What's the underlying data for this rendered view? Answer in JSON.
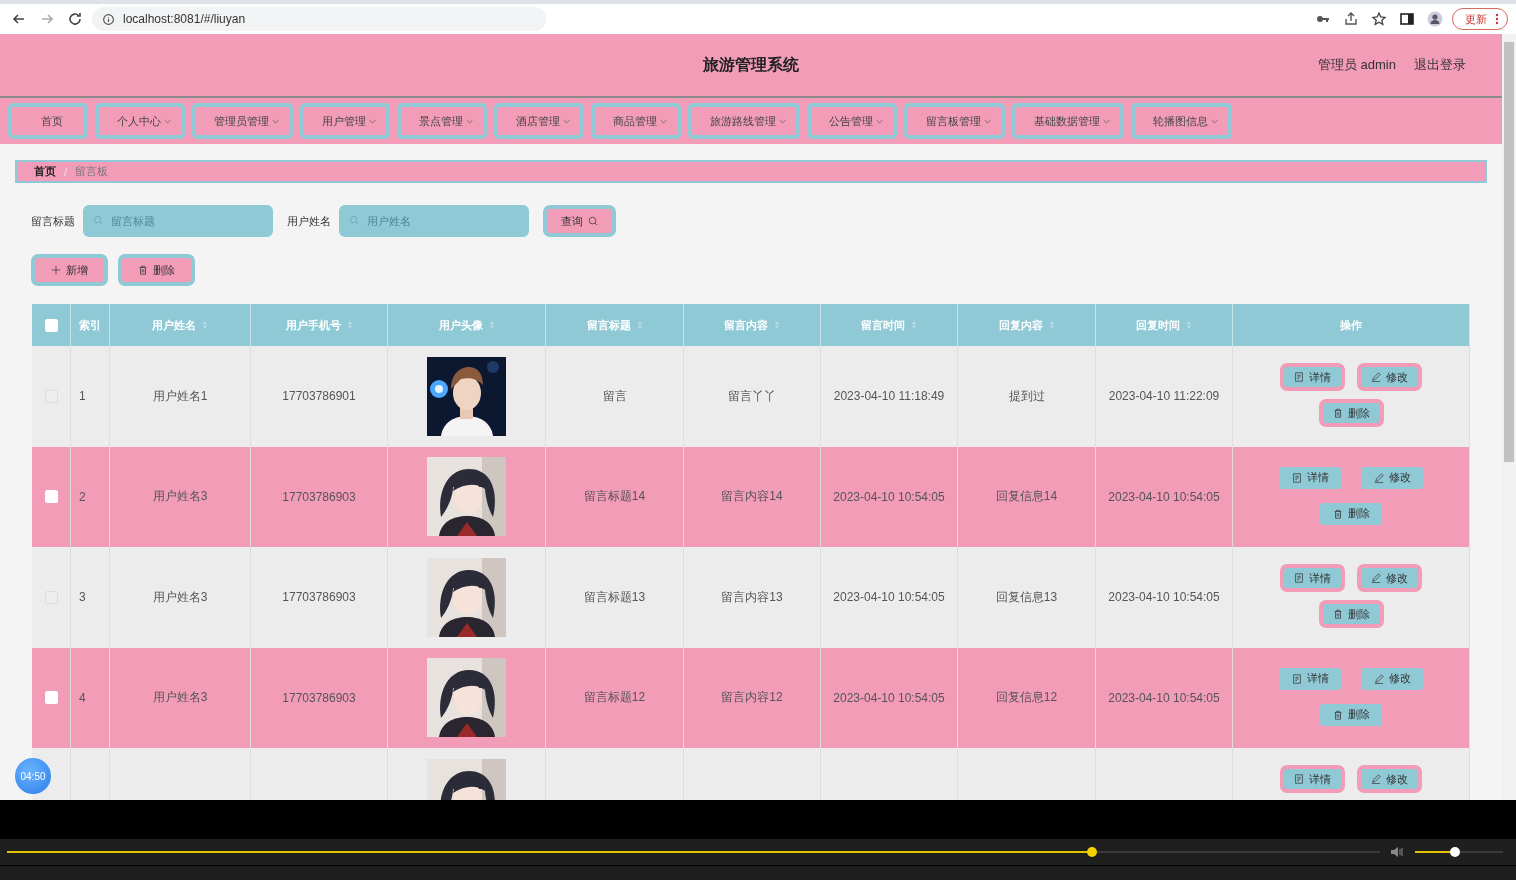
{
  "browser": {
    "url": "localhost:8081/#/liuyan",
    "update_label": "更新"
  },
  "header": {
    "title": "旅游管理系统",
    "user": "管理员 admin",
    "logout": "退出登录"
  },
  "nav": [
    {
      "label": "首页",
      "dropdown": false
    },
    {
      "label": "个人中心",
      "dropdown": true
    },
    {
      "label": "管理员管理",
      "dropdown": true
    },
    {
      "label": "用户管理",
      "dropdown": true
    },
    {
      "label": "景点管理",
      "dropdown": true
    },
    {
      "label": "酒店管理",
      "dropdown": true
    },
    {
      "label": "商品管理",
      "dropdown": true
    },
    {
      "label": "旅游路线管理",
      "dropdown": true
    },
    {
      "label": "公告管理",
      "dropdown": true
    },
    {
      "label": "留言板管理",
      "dropdown": true
    },
    {
      "label": "基础数据管理",
      "dropdown": true
    },
    {
      "label": "轮播图信息",
      "dropdown": true
    }
  ],
  "breadcrumb": {
    "separator": "/",
    "items": [
      {
        "label": "首页",
        "current": false
      },
      {
        "label": "留言板",
        "current": true
      }
    ]
  },
  "search": {
    "fields": [
      {
        "label": "留言标题",
        "placeholder": "留言标题"
      },
      {
        "label": "用户姓名",
        "placeholder": "用户姓名"
      }
    ],
    "button": "查询"
  },
  "actions": [
    {
      "label": "新增",
      "kind": "add"
    },
    {
      "label": "删除",
      "kind": "delete"
    }
  ],
  "table": {
    "all_checked": false,
    "columns": [
      {
        "label": "索引",
        "sortable": false
      },
      {
        "label": "用户姓名",
        "sortable": true
      },
      {
        "label": "用户手机号",
        "sortable": true
      },
      {
        "label": "用户头像",
        "sortable": true
      },
      {
        "label": "留言标题",
        "sortable": true
      },
      {
        "label": "留言内容",
        "sortable": true
      },
      {
        "label": "留言时间",
        "sortable": true
      },
      {
        "label": "回复内容",
        "sortable": true
      },
      {
        "label": "回复时间",
        "sortable": true
      },
      {
        "label": "操作",
        "sortable": false
      }
    ],
    "rows": [
      {
        "checked": false,
        "cells": [
          "1",
          "用户姓名1",
          "17703786901",
          null,
          "留言",
          "留言丫丫",
          "2023-04-10 11:18:49",
          "提到过",
          "2023-04-10 11:22:09"
        ],
        "actions": [
          {
            "label": "详情",
            "kind": "detail"
          },
          {
            "label": "修改",
            "kind": "edit"
          },
          {
            "label": "删除",
            "kind": "delete"
          }
        ]
      },
      {
        "checked": false,
        "cells": [
          "2",
          "用户姓名3",
          "17703786903",
          null,
          "留言标题14",
          "留言内容14",
          "2023-04-10 10:54:05",
          "回复信息14",
          "2023-04-10 10:54:05"
        ],
        "actions": [
          {
            "label": "详情",
            "kind": "detail"
          },
          {
            "label": "修改",
            "kind": "edit"
          },
          {
            "label": "删除",
            "kind": "delete"
          }
        ]
      },
      {
        "checked": false,
        "cells": [
          "3",
          "用户姓名3",
          "17703786903",
          null,
          "留言标题13",
          "留言内容13",
          "2023-04-10 10:54:05",
          "回复信息13",
          "2023-04-10 10:54:05"
        ],
        "actions": [
          {
            "label": "详情",
            "kind": "detail"
          },
          {
            "label": "修改",
            "kind": "edit"
          },
          {
            "label": "删除",
            "kind": "delete"
          }
        ]
      },
      {
        "checked": false,
        "cells": [
          "4",
          "用户姓名3",
          "17703786903",
          null,
          "留言标题12",
          "留言内容12",
          "2023-04-10 10:54:05",
          "回复信息12",
          "2023-04-10 10:54:05"
        ],
        "actions": [
          {
            "label": "详情",
            "kind": "detail"
          },
          {
            "label": "修改",
            "kind": "edit"
          },
          {
            "label": "删除",
            "kind": "delete"
          }
        ]
      },
      {
        "cells": [
          null,
          null,
          null,
          null,
          null,
          null,
          null,
          null,
          null
        ],
        "actions": [
          {
            "label": "详情",
            "kind": "detail"
          },
          {
            "label": "修改",
            "kind": "edit"
          }
        ]
      }
    ]
  },
  "player": {
    "timestamp": "04:50"
  }
}
